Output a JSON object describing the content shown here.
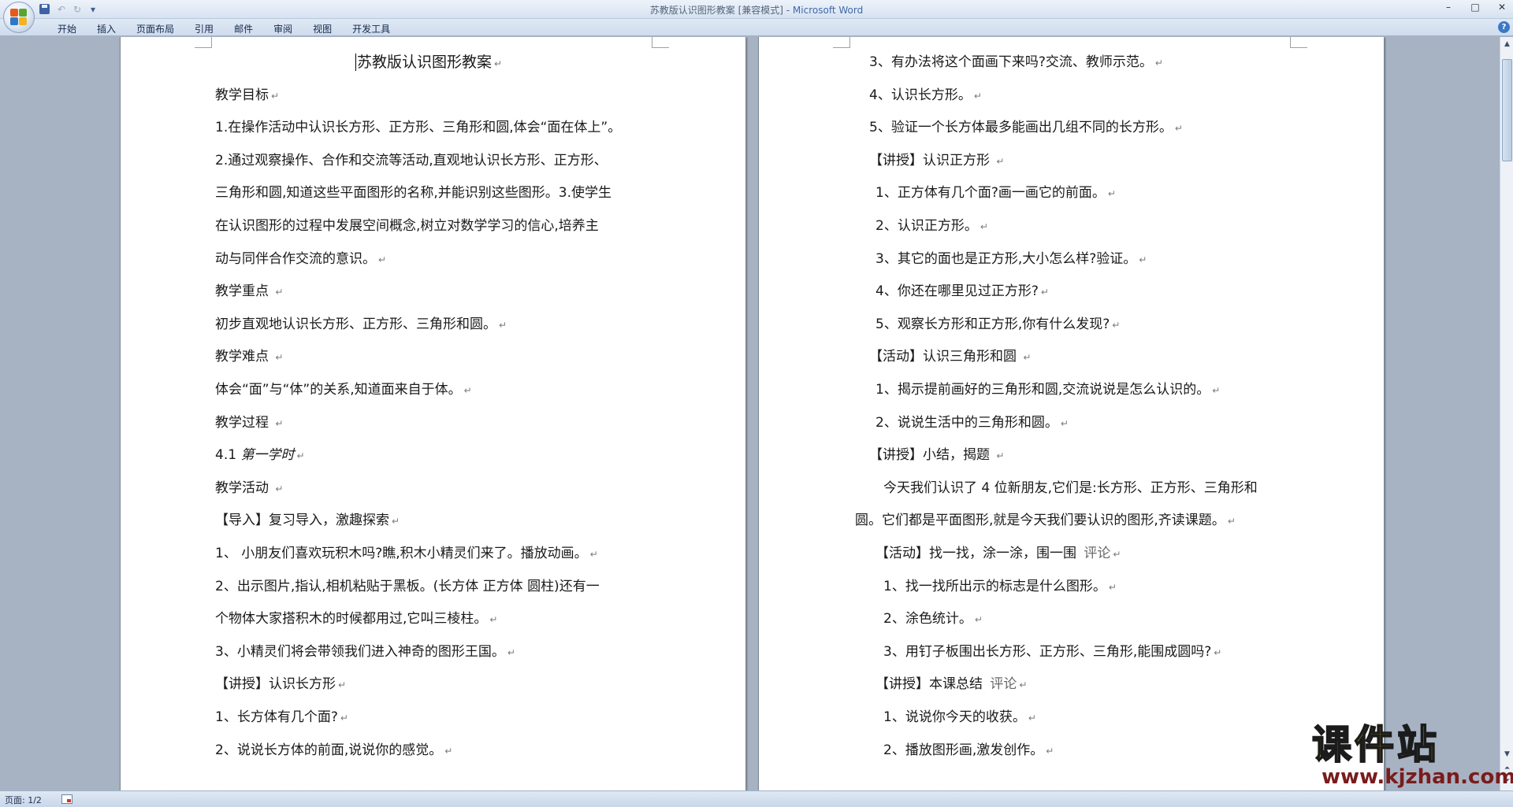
{
  "window": {
    "title_doc": "苏教版认识图形教案 [兼容模式] - ",
    "title_app": "Microsoft Word",
    "controls": [
      "–",
      "□",
      "✕"
    ]
  },
  "ribbon": {
    "tabs": [
      "开始",
      "插入",
      "页面布局",
      "引用",
      "邮件",
      "审阅",
      "视图",
      "开发工具"
    ],
    "help": "?"
  },
  "icons": {
    "office_button": "office-logo-icon",
    "save": "save-icon",
    "undo": "undo-icon",
    "redo": "redo-icon",
    "customize": "dropdown-icon"
  },
  "page1": {
    "lines": [
      {
        "text": "苏教版认识图形教案",
        "mark": "↵"
      },
      {
        "text": "教学目标",
        "mark": "↵"
      },
      {
        "text": "1.在操作活动中认识长方形、正方形、三角形和圆,体会“面在体上”。",
        "mark": ""
      },
      {
        "text": "2.通过观察操作、合作和交流等活动,直观地认识长方形、正方形、",
        "mark": ""
      },
      {
        "text": "三角形和圆,知道这些平面图形的名称,并能识别这些图形。3.使学生",
        "mark": ""
      },
      {
        "text": "在认识图形的过程中发展空间概念,树立对数学学习的信心,培养主",
        "mark": ""
      },
      {
        "text": "动与同伴合作交流的意识。",
        "mark": "↵"
      },
      {
        "text": "教学重点 ",
        "mark": "↵"
      },
      {
        "text": "初步直观地认识长方形、正方形、三角形和圆。",
        "mark": "↵"
      },
      {
        "text": "教学难点 ",
        "mark": "↵"
      },
      {
        "text": "体会“面”与“体”的关系,知道面来自于体。",
        "mark": "↵"
      },
      {
        "text": "教学过程 ",
        "mark": "↵"
      },
      {
        "text": "4.1 ",
        "italic": "第一学时",
        "mark": "↵"
      },
      {
        "text": "教学活动 ",
        "mark": "↵"
      },
      {
        "text": "【导入】复习导入，激趣探索",
        "mark": "↵"
      },
      {
        "text": "1、 小朋友们喜欢玩积木吗?瞧,积木小精灵们来了。播放动画。",
        "mark": "↵"
      },
      {
        "text": "2、出示图片,指认,相机粘贴于黑板。(长方体 正方体 圆柱)还有一",
        "mark": ""
      },
      {
        "text": "个物体大家搭积木的时候都用过,它叫三棱柱。",
        "mark": "↵"
      },
      {
        "text": "3、小精灵们将会带领我们进入神奇的图形王国。",
        "mark": "↵"
      },
      {
        "text": "【讲授】认识长方形",
        "mark": "↵"
      },
      {
        "text": " 1、长方体有几个面?",
        "mark": "↵"
      },
      {
        "text": " 2、说说长方体的前面,说说你的感觉。",
        "mark": "↵"
      }
    ]
  },
  "page2": {
    "lines": [
      {
        "text": "3、有办法将这个面画下来吗?交流、教师示范。",
        "mark": "↵"
      },
      {
        "text": "4、认识长方形。",
        "mark": "↵"
      },
      {
        "text": "5、验证一个长方体最多能画出几组不同的长方形。",
        "mark": "↵"
      },
      {
        "text": "【讲授】认识正方形 ",
        "mark": "↵"
      },
      {
        "text": "1、正方体有几个面?画一画它的前面。",
        "mark": "↵"
      },
      {
        "text": "2、认识正方形。",
        "mark": "↵"
      },
      {
        "text": "3、其它的面也是正方形,大小怎么样?验证。",
        "mark": "↵"
      },
      {
        "text": "4、你还在哪里见过正方形?",
        "mark": "↵"
      },
      {
        "text": "5、观察长方形和正方形,你有什么发现?",
        "mark": "↵"
      },
      {
        "text": "【活动】认识三角形和圆 ",
        "mark": "↵"
      },
      {
        "text": "1、揭示提前画好的三角形和圆,交流说说是怎么认识的。",
        "mark": "↵"
      },
      {
        "text": "2、说说生活中的三角形和圆。",
        "mark": "↵"
      },
      {
        "text": "【讲授】小结，揭题 ",
        "mark": "↵"
      },
      {
        "text": "今天我们认识了 4 位新朋友,它们是:长方形、正方形、三角形和",
        "mark": ""
      },
      {
        "text": "圆。它们都是平面图形,就是今天我们要认识的图形,齐读课题。",
        "mark": "↵"
      },
      {
        "text": "【活动】找一找，涂一涂，围一围 ",
        "comment": "评论",
        "mark": "↵"
      },
      {
        "text": "1、找一找所出示的标志是什么图形。",
        "mark": "↵"
      },
      {
        "text": "2、涂色统计。",
        "mark": "↵"
      },
      {
        "text": "3、用钉子板围出长方形、正方形、三角形,能围成圆吗?",
        "mark": "↵"
      },
      {
        "text": "【讲授】本课总结 ",
        "comment": "评论",
        "mark": "↵"
      },
      {
        "text": "1、说说你今天的收获。",
        "mark": "↵"
      },
      {
        "text": "2、播放图形画,激发创作。",
        "mark": "↵"
      }
    ]
  },
  "status": {
    "page": "页面: 1/2"
  },
  "watermark": {
    "main": "课件站",
    "sub": "www.kjzhan.com"
  }
}
